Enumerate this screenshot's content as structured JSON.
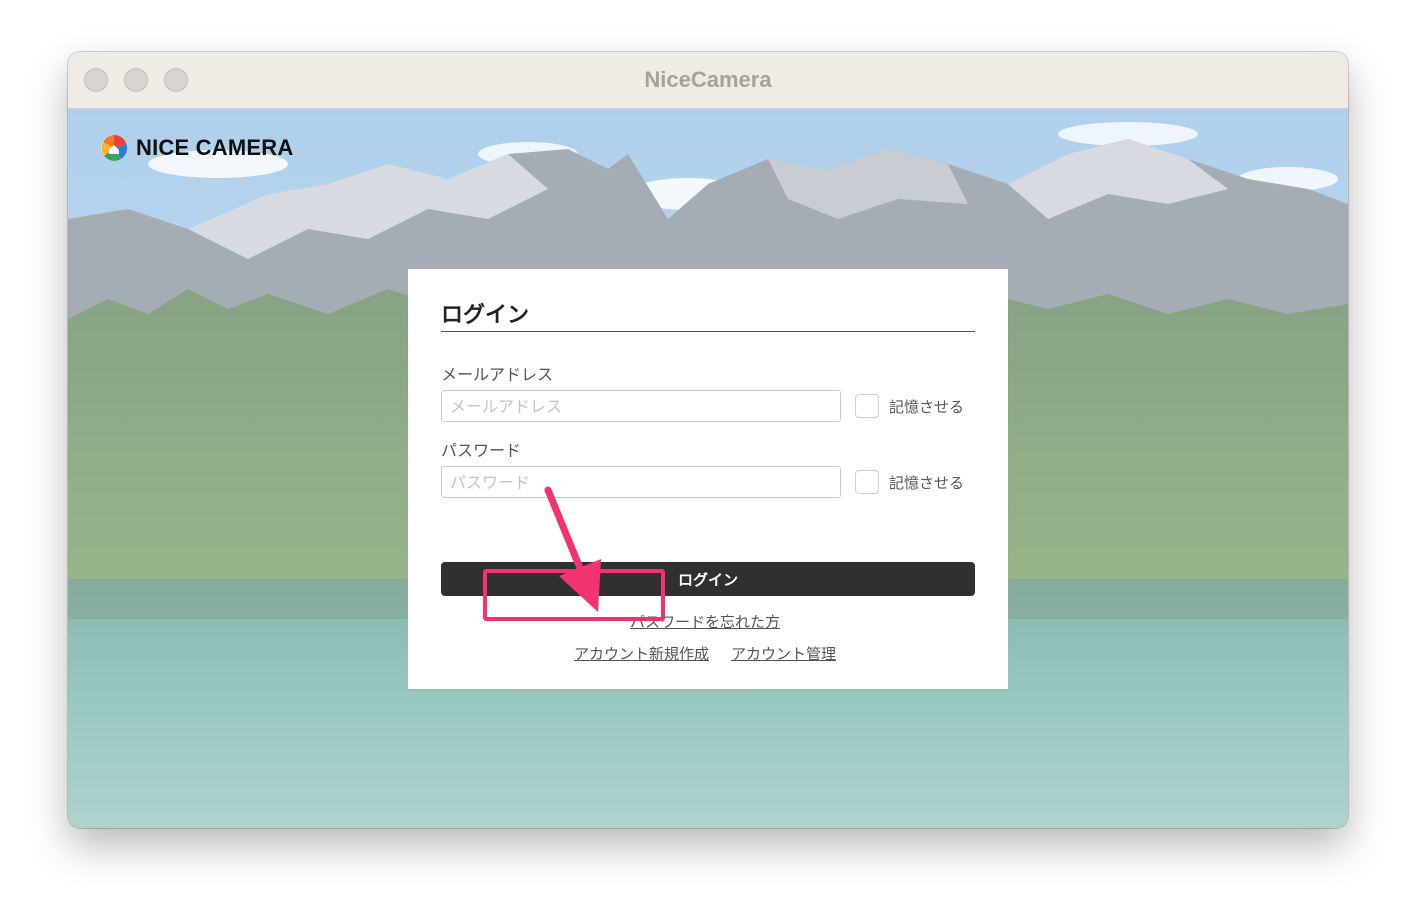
{
  "window": {
    "title": "NiceCamera"
  },
  "brand": {
    "name": "NICE CAMERA",
    "logo_icon": "aperture-logo-icon"
  },
  "login": {
    "heading": "ログイン",
    "email": {
      "label": "メールアドレス",
      "placeholder": "メールアドレス",
      "value": "",
      "remember_label": "記憶させる",
      "remember_checked": false
    },
    "password": {
      "label": "パスワード",
      "placeholder": "パスワード",
      "value": "",
      "remember_label": "記憶させる",
      "remember_checked": false
    },
    "submit_label": "ログイン",
    "forgot_password_label": "パスワードを忘れた方",
    "create_account_label": "アカウント新規作成",
    "manage_account_label": "アカウント管理"
  },
  "annotation": {
    "color": "#f2336f",
    "target": "アカウント新規作成"
  },
  "colors": {
    "titlebar": "#f0ebe5",
    "button": "#303030",
    "accent": "#f2336f"
  }
}
